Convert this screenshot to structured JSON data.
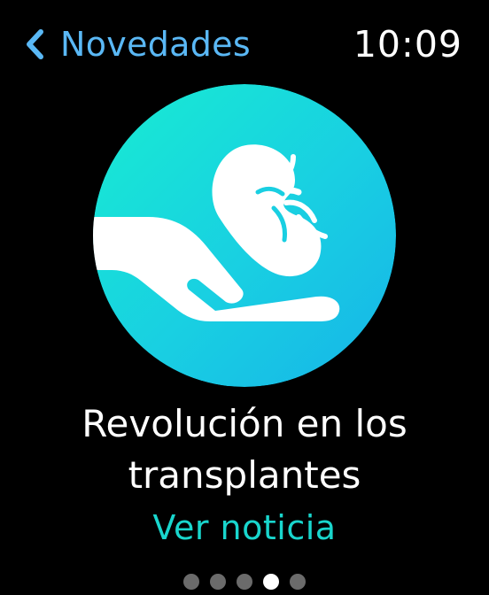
{
  "nav": {
    "back_label": "Novedades",
    "back_icon": "chevron-left-icon"
  },
  "status": {
    "time": "10:09"
  },
  "hero": {
    "icon": "hand-holding-kidney-icon",
    "gradient": [
      "#17e6d6",
      "#19c9e4",
      "#16b8e6"
    ]
  },
  "article": {
    "headline_line1": "Revolución en los",
    "headline_line2": "transplantes",
    "cta_label": "Ver noticia"
  },
  "pagination": {
    "total": 5,
    "current": 4
  },
  "colors": {
    "accent_blue": "#5ab8f5",
    "accent_teal": "#19d6cd",
    "background": "#000000",
    "dot_inactive": "#6b6b6b",
    "dot_active": "#ffffff"
  }
}
